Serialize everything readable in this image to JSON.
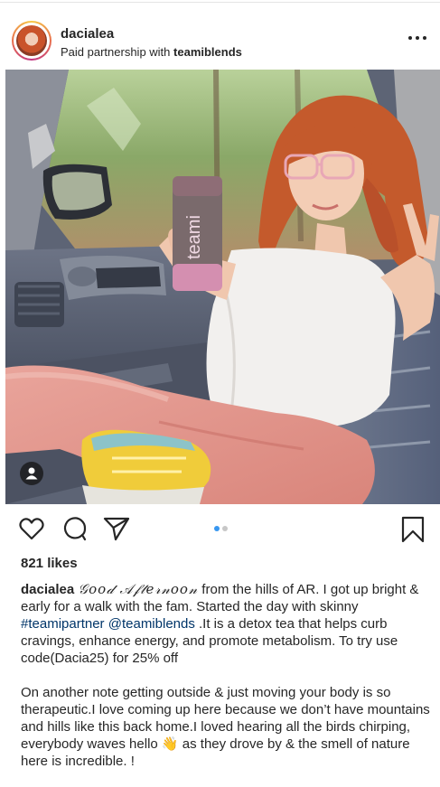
{
  "post": {
    "username": "dacialea",
    "partnership_prefix": "Paid partnership with",
    "partner": "teamiblends",
    "product_label": "teami",
    "likes": "821 likes"
  },
  "carousel": {
    "total": 2,
    "active": 0
  },
  "icons": {
    "more": "more-options-icon",
    "like": "heart-icon",
    "comment": "comment-bubble-icon",
    "share": "paper-plane-icon",
    "save": "bookmark-icon",
    "tag": "user-tag-icon"
  },
  "caption": {
    "username": "dacialea",
    "greeting": "𝒢𝑜𝑜𝒹 𝒜𝒻𝓉𝑒𝓇𝓃𝑜𝑜𝓃",
    "p1_a": " from the hills of AR. I got up bright & early for a walk with the fam. Started the day with skinny ",
    "hashtag": "#teamipartner",
    "space": " ",
    "mention": "@teamiblends",
    "p1_b": " .It is a detox tea that helps curb cravings, enhance energy, and promote metabolism. To try use code(Dacia25) for 25% off",
    "p2_a": "On another note getting outside &  just moving your body is so therapeutic.I love coming up here because we don’t have mountains and hills like this back home.I loved hearing all the birds chirping, everybody waves hello ",
    "emoji": "👋",
    "p2_b": " as they drove by & the smell of nature here is incredible. !"
  },
  "colors": {
    "text": "#262626",
    "link": "#003569",
    "carousel_active": "#3897f0",
    "carousel_inactive": "#c7c7c7"
  }
}
